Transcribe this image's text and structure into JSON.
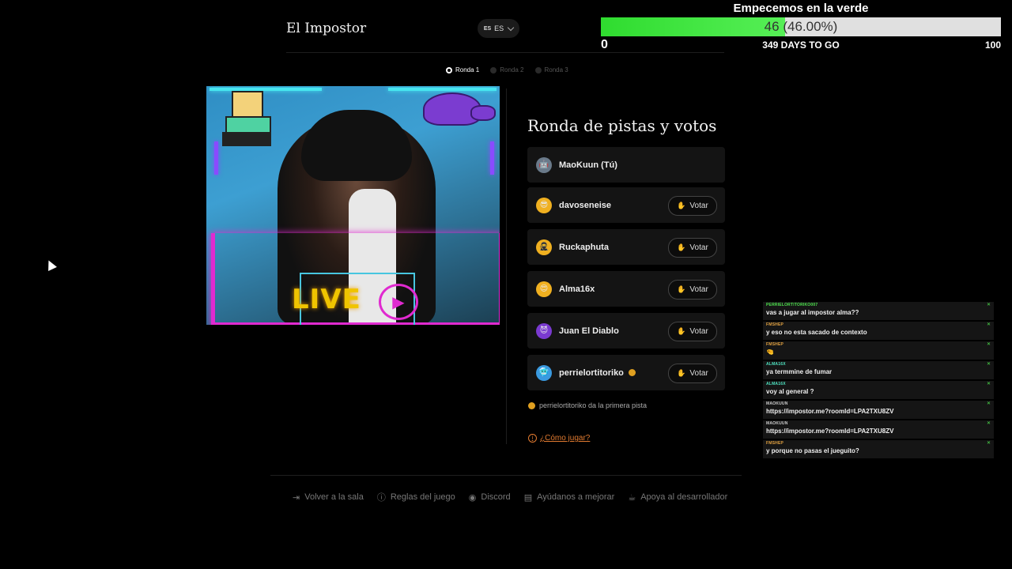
{
  "app": {
    "brand": "El Impostor",
    "lang_flag": "ES",
    "lang_code": "ES"
  },
  "goal": {
    "title": "Empecemos en la verde",
    "current": "46",
    "percent_label": "(46.00%)",
    "progress_fraction": 0.46,
    "min": "0",
    "max": "100",
    "days_left": "349 DAYS TO GO",
    "fill_color": "#2fdc2f"
  },
  "rounds": [
    {
      "label": "Ronda 1",
      "active": true
    },
    {
      "label": "Ronda 2",
      "active": false
    },
    {
      "label": "Ronda 3",
      "active": false
    }
  ],
  "webcam": {
    "overlay_text": "LIVE"
  },
  "panel": {
    "title": "Ronda de pistas y votos",
    "vote_label": "Votar",
    "players": [
      {
        "name": "MaoKuun (Tú)",
        "avatar_color": "#6a7a8a",
        "avatar_icon": "robot-face-icon",
        "can_vote": false
      },
      {
        "name": "davoseneise",
        "avatar_color": "#f0b020",
        "avatar_icon": "sunglasses-face-icon",
        "can_vote": true
      },
      {
        "name": "Ruckaphuta",
        "avatar_color": "#f0b020",
        "avatar_icon": "ninja-face-icon",
        "can_vote": true
      },
      {
        "name": "Alma16x",
        "avatar_color": "#f0b020",
        "avatar_icon": "heart-eyes-face-icon",
        "can_vote": true
      },
      {
        "name": "Juan El Diablo",
        "avatar_color": "#7a3ad0",
        "avatar_icon": "devil-face-icon",
        "can_vote": true
      },
      {
        "name": "perrielortitoriko",
        "avatar_color": "#3a9ae0",
        "avatar_icon": "cold-face-icon",
        "can_vote": true,
        "has_coin": true
      }
    ],
    "clue_note": "perrielortitoriko da la primera pista",
    "howto": "¿Cómo jugar?"
  },
  "footer": {
    "items": [
      {
        "label": "Volver a la sala",
        "icon": "exit-icon"
      },
      {
        "label": "Reglas del juego",
        "icon": "info-icon"
      },
      {
        "label": "Discord",
        "icon": "discord-icon"
      },
      {
        "label": "Ayúdanos a mejorar",
        "icon": "feedback-icon"
      },
      {
        "label": "Apoya al desarrollador",
        "icon": "coffee-icon"
      }
    ]
  },
  "chat": {
    "messages": [
      {
        "user": "PERRIELORTITORIKO007",
        "text": "vas a jugar al impostor alma??",
        "color": "#4ee24e"
      },
      {
        "user": "FMSHEP",
        "text": "y eso no esta sacado de contexto",
        "color": "#e0a040"
      },
      {
        "user": "FMSHEP",
        "text": "🤏",
        "color": "#e0a040"
      },
      {
        "user": "ALMA16X",
        "text": "ya termmine de fumar",
        "color": "#4ee2c0"
      },
      {
        "user": "ALMA16X",
        "text": "voy al general ?",
        "color": "#4ee2c0"
      },
      {
        "user": "MAOKUUN",
        "text": "https://impostor.me?roomId=LPA2TXU8ZV",
        "color": "#cccccc"
      },
      {
        "user": "MAOKUUN",
        "text": "https://impostor.me?roomId=LPA2TXU8ZV",
        "color": "#cccccc"
      },
      {
        "user": "FMSHEP",
        "text": "y porque no pasas el jueguito?",
        "color": "#e0a040"
      }
    ]
  }
}
